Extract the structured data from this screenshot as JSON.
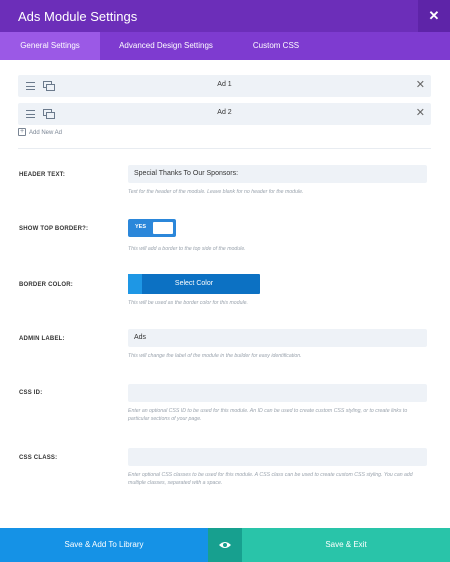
{
  "header": {
    "title": "Ads Module Settings",
    "close_symbol": "✕"
  },
  "tabs": [
    {
      "label": "General Settings",
      "active": true
    },
    {
      "label": "Advanced Design Settings",
      "active": false
    },
    {
      "label": "Custom CSS",
      "active": false
    }
  ],
  "ads": [
    {
      "label": "Ad 1"
    },
    {
      "label": "Ad 2"
    }
  ],
  "add_new_ad": "Add New Ad",
  "fields": {
    "header_text": {
      "label": "HEADER TEXT:",
      "value": "Special Thanks To Our Sponsors:",
      "desc": "Text for the header of the module. Leave blank for no header for the module."
    },
    "show_top_border": {
      "label": "SHOW TOP BORDER?:",
      "toggle_label": "YES",
      "desc": "This will add a border to the top side of the module."
    },
    "border_color": {
      "label": "BORDER COLOR:",
      "button_label": "Select Color",
      "desc": "This will be used as the border color for this module."
    },
    "admin_label": {
      "label": "ADMIN LABEL:",
      "value": "Ads",
      "desc": "This will change the label of the module in the builder for easy identification."
    },
    "css_id": {
      "label": "CSS ID:",
      "value": "",
      "desc": "Enter an optional CSS ID to be used for this module. An ID can be used to create custom CSS styling, or to create links to particular sections of your page."
    },
    "css_class": {
      "label": "CSS CLASS:",
      "value": "",
      "desc": "Enter optional CSS classes to be used for this module. A CSS class can be used to create custom CSS styling. You can add multiple classes, separated with a space."
    }
  },
  "footer": {
    "save_library": "Save & Add To Library",
    "save_exit": "Save & Exit"
  },
  "colors": {
    "header": "#6c2eb9",
    "tabs": "#7e3bd0",
    "active_tab": "#9b59e6",
    "toggle": "#2b87da",
    "color_button": "#0c71c3",
    "save_library": "#1592e6",
    "preview": "#17a08f",
    "save_exit": "#29c4a9"
  },
  "icons": {
    "drag": "hamburger-icon",
    "duplicate": "duplicate-icon",
    "remove": "close-icon",
    "add": "plus-icon",
    "preview": "eye-icon"
  }
}
